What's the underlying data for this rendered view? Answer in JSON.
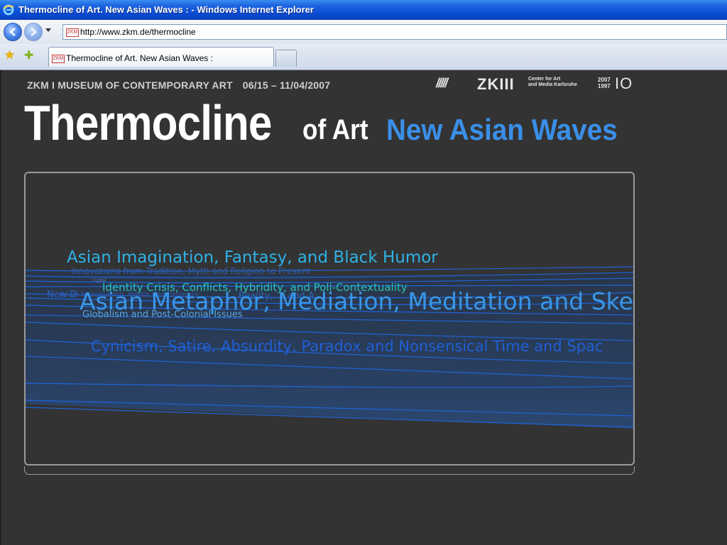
{
  "window": {
    "title": "Thermocline of Art. New Asian Waves : - Windows Internet Explorer"
  },
  "address_bar": {
    "url": "http://www.zkm.de/thermocline",
    "favicon_text": "ZKM"
  },
  "tabs": [
    {
      "label": "Thermocline of Art. New Asian Waves :",
      "favicon_text": "ZKM"
    }
  ],
  "page": {
    "museum_line": "ZKM I MUSEUM OF CONTEMPORARY ART",
    "dates": "06/15 – 11/04/2007",
    "logo": {
      "slashes": "/////",
      "name": "ZKIII",
      "sub_line1": "Center for Art",
      "sub_line2": "and Media Karlsruhe",
      "year_top": "2007",
      "year_bottom": "1997",
      "anniversary": "IO"
    },
    "title_main": "Thermocline",
    "title_of": "of Art",
    "title_blue": "New Asian Waves",
    "themes": {
      "asian_imagination": "Asian Imagination, Fantasy, and Black Humor",
      "innovations": "Innovations from Tradition, Myth and Religion to Present",
      "identity": "Identity Crisis, Conflicts, Hybridity, and Poli-Contextuality",
      "new_d": "New D",
      "asian_imagination_small": "Asian Imagination, Media and Paranoia",
      "digital_small": "Digital",
      "asian_metaphor": "Asian Metaphor, Mediation, Meditation and Skep",
      "globalism": "Globalism and Post-Colonial Issues",
      "cynicism": "Cynicism, Satire, Absurdity, Paradox and Nonsensical Time and Spac",
      "reality": "Reality, ... and A..."
    }
  },
  "colors": {
    "page_background": "#333333",
    "accent_blue": "#3a8fe8",
    "wave_blue": "#1e64d8",
    "teal": "#29c2b8"
  }
}
